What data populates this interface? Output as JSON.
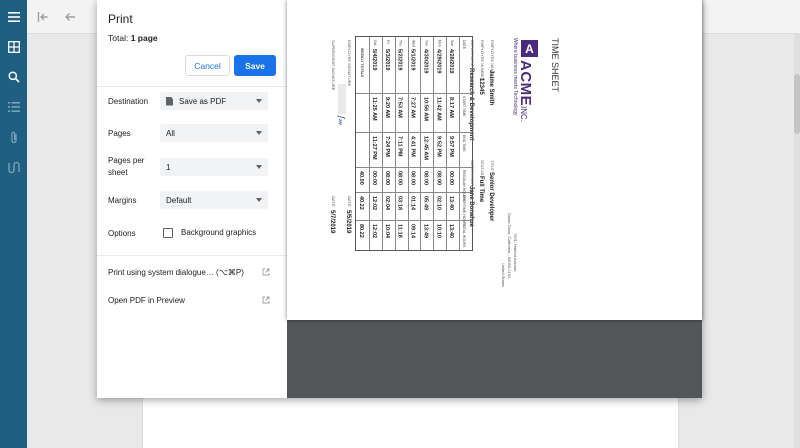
{
  "print": {
    "title": "Print",
    "total_label": "Total:",
    "total_value": "1 page",
    "cancel_label": "Cancel",
    "save_label": "Save",
    "destination_label": "Destination",
    "destination_value": "Save as PDF",
    "pages_label": "Pages",
    "pages_value": "All",
    "pages_per_sheet_label": "Pages per sheet",
    "pages_per_sheet_value": "1",
    "margins_label": "Margins",
    "margins_value": "Default",
    "options_label": "Options",
    "background_graphics_label": "Background graphics",
    "background_graphics_checked": false,
    "system_dialog_label": "Print using system dialogue… (⌥⌘P)",
    "open_pdf_label": "Open PDF in Preview"
  },
  "timesheet": {
    "title": "TIME SHEET",
    "company": "ACME",
    "company_suffix": "INC.",
    "tagline": "Where business meets Technology",
    "address_1": "7901, Halford Avenue,",
    "address_2": "Santa Clara, California - 95050-2152,",
    "address_3": "United States",
    "employee_name_label": "EMPLOYEE NAME",
    "employee_name": "Jaime Smith",
    "employee_number_label": "EMPLOYEE NUMBER",
    "employee_number": "12345",
    "department_label": "DEPARTMENT",
    "department": "Research & Development",
    "title_label": "TITLE",
    "job_title": "Senior Developer",
    "status_label": "STATUS",
    "status": "Full Time",
    "supervisor_label": "SUPERVISOR",
    "supervisor": "Jane Donahue",
    "columns": [
      "DATE",
      "START TIME",
      "END TIME",
      "REGULAR HOURS",
      "OVERTIME HOURS",
      "TOTAL HOURS"
    ],
    "rows": [
      {
        "day": "Sun",
        "date": "4/28/2019",
        "start": "8:17 AM",
        "end": "9:57 PM",
        "regular": "00:00",
        "overtime": "13:40",
        "total": "13:40"
      },
      {
        "day": "Mon",
        "date": "4/29/2019",
        "start": "11:42 AM",
        "end": "9:52 PM",
        "regular": "08:00",
        "overtime": "02:10",
        "total": "10:10"
      },
      {
        "day": "Tue",
        "date": "4/30/2019",
        "start": "10:56 AM",
        "end": "12:45 AM",
        "regular": "08:00",
        "overtime": "05:49",
        "total": "13:49"
      },
      {
        "day": "Wed",
        "date": "5/1/2019",
        "start": "7:27 AM",
        "end": "4:41 PM",
        "regular": "08:00",
        "overtime": "01:14",
        "total": "09:14"
      },
      {
        "day": "Thu",
        "date": "5/2/2019",
        "start": "7:53 AM",
        "end": "7:11 PM",
        "regular": "08:00",
        "overtime": "03:18",
        "total": "11:18"
      },
      {
        "day": "Fri",
        "date": "5/3/2019",
        "start": "9:20 AM",
        "end": "7:24 PM",
        "regular": "08:00",
        "overtime": "02:04",
        "total": "10:04"
      },
      {
        "day": "Sat",
        "date": "5/4/2019",
        "start": "11:25 AM",
        "end": "11:27 PM",
        "regular": "00:00",
        "overtime": "12:02",
        "total": "12:02"
      }
    ],
    "weekly_totals_label": "WEEKLY TOTALS",
    "weekly_regular": "40.00",
    "weekly_overtime": "40.22",
    "weekly_total": "80.22",
    "employee_signature_label": "EMPLOYEE SIGNATURE",
    "supervisor_signature_label": "SUPERVISOR SIGNATURE",
    "date_label": "DATE",
    "employee_sign_date": "5/5/2019",
    "supervisor_sign_date": "5/7/2019"
  },
  "colors": {
    "rail": "#1f5f82",
    "accent": "#1a73e8",
    "brand": "#4b2a7b",
    "preview_bg": "#525659"
  }
}
